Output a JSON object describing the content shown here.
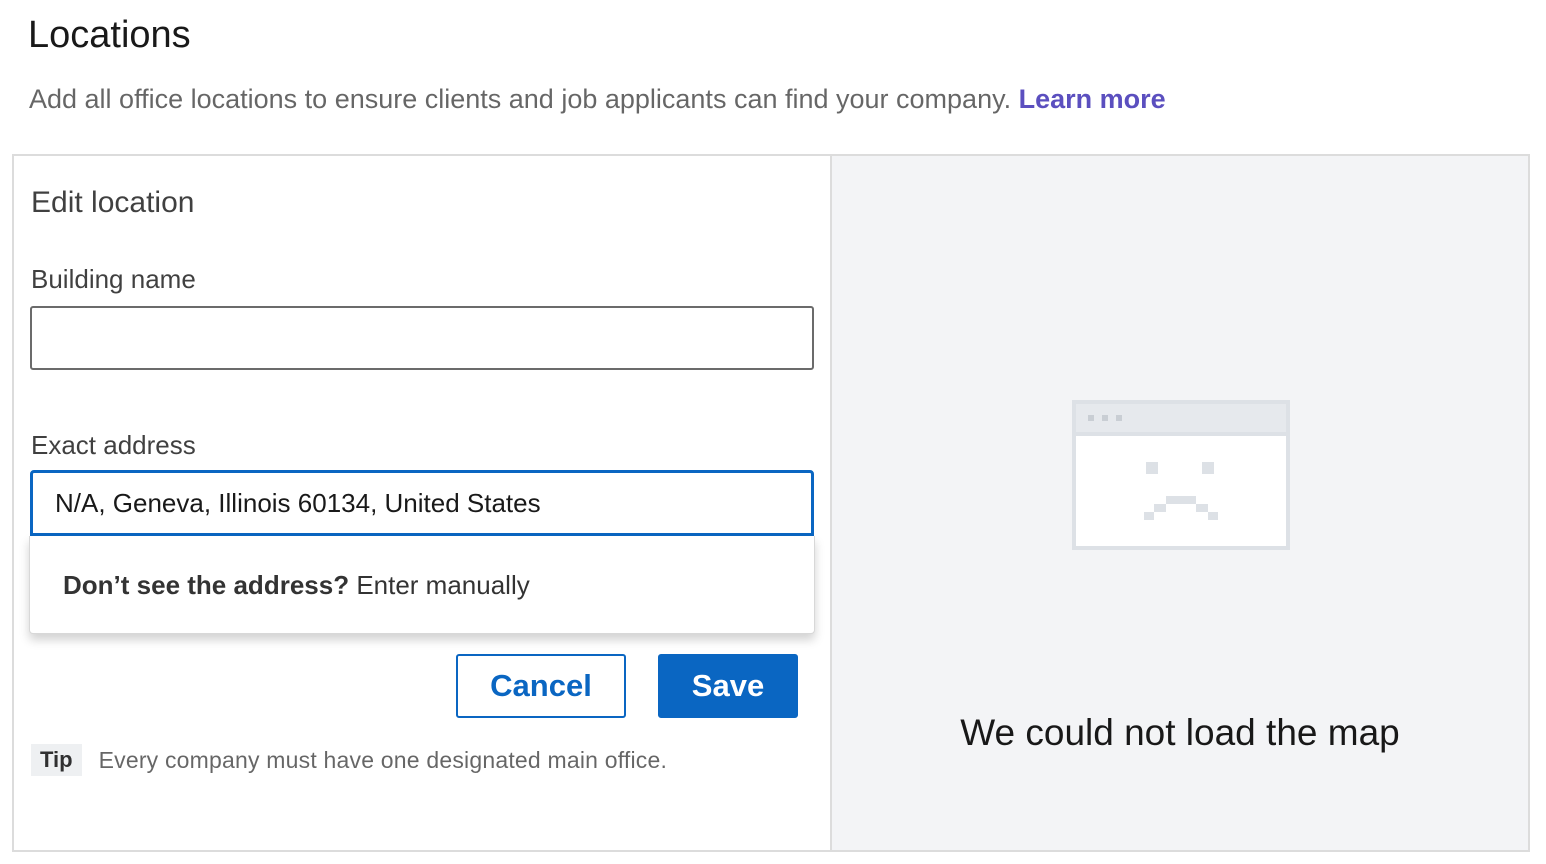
{
  "header": {
    "title": "Locations",
    "description": "Add all office locations to ensure clients and job applicants can find your company.",
    "learn_more": "Learn more"
  },
  "form": {
    "title": "Edit location",
    "building_label": "Building name",
    "building_value": "",
    "address_label": "Exact address",
    "address_value": "N/A, Geneva, Illinois 60134, United States",
    "suggestion_bold": "Don’t see the address?",
    "suggestion_action": "Enter manually",
    "cancel_label": "Cancel",
    "save_label": "Save",
    "tip_badge": "Tip",
    "tip_text": "Every company must have one designated main office."
  },
  "map": {
    "error_text": "We could not load the map",
    "icon": "broken-window-sad-face-icon"
  },
  "colors": {
    "accent": "#0a66c2",
    "link": "#5b4fbf",
    "map_bg": "#f3f4f6"
  }
}
